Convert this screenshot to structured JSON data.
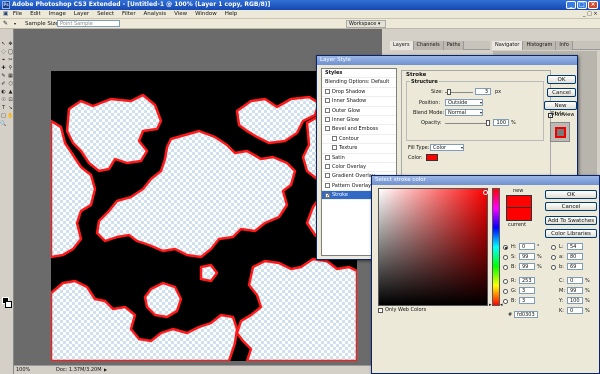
{
  "window": {
    "title": "Adobe Photoshop CS3 Extended - [Untitled-1 @ 100% (Layer 1 copy, RGB/8)]",
    "app_icon": "Ps"
  },
  "menu": [
    "File",
    "Edit",
    "Image",
    "Layer",
    "Select",
    "Filter",
    "Analysis",
    "View",
    "Window",
    "Help"
  ],
  "options": {
    "sample_size_label": "Sample Size:",
    "sample_size_value": "Point Sample",
    "workspace_label": "Workspace"
  },
  "status": {
    "zoom": "100%",
    "doc": "Doc: 1.37M/3.20M"
  },
  "panels": {
    "left_tabs": [
      "Layers",
      "Channels",
      "Paths"
    ],
    "right_tabs": [
      "Navigator",
      "Histogram",
      "Info"
    ]
  },
  "layer_style": {
    "title": "Layer Style",
    "list": [
      {
        "label": "Styles",
        "checkbox": false
      },
      {
        "label": "Blending Options: Default",
        "checkbox": false
      },
      {
        "label": "Drop Shadow",
        "checkbox": true
      },
      {
        "label": "Inner Shadow",
        "checkbox": true
      },
      {
        "label": "Outer Glow",
        "checkbox": true
      },
      {
        "label": "Inner Glow",
        "checkbox": true
      },
      {
        "label": "Bevel and Emboss",
        "checkbox": true
      },
      {
        "label": "Contour",
        "checkbox": true,
        "indent": true
      },
      {
        "label": "Texture",
        "checkbox": true,
        "indent": true
      },
      {
        "label": "Satin",
        "checkbox": true
      },
      {
        "label": "Color Overlay",
        "checkbox": true
      },
      {
        "label": "Gradient Overlay",
        "checkbox": true
      },
      {
        "label": "Pattern Overlay",
        "checkbox": true
      },
      {
        "label": "Stroke",
        "checkbox": true,
        "checked": true,
        "selected": true
      }
    ],
    "section_title": "Stroke",
    "group_title": "Structure",
    "size_label": "Size:",
    "size_value": "3",
    "size_unit": "px",
    "position_label": "Position:",
    "position_value": "Outside",
    "blend_label": "Blend Mode:",
    "blend_value": "Normal",
    "opacity_label": "Opacity:",
    "opacity_value": "100",
    "opacity_unit": "%",
    "fill_type_label": "Fill Type:",
    "fill_type_value": "Color",
    "color_label": "Color:",
    "stroke_color": "#ff0000",
    "ok": "OK",
    "cancel": "Cancel",
    "new_style": "New Style...",
    "preview": "Preview"
  },
  "color_picker": {
    "title": "Select stroke color",
    "new_label": "new",
    "current_label": "current",
    "new_color": "#ff0303",
    "current_color": "#ff0000",
    "ok": "OK",
    "cancel": "Cancel",
    "add_swatches": "Add To Swatches",
    "color_libraries": "Color Libraries",
    "only_web": "Only Web Colors",
    "hsb": [
      {
        "label": "H:",
        "value": "0",
        "unit": "°"
      },
      {
        "label": "S:",
        "value": "99",
        "unit": "%"
      },
      {
        "label": "B:",
        "value": "99",
        "unit": "%"
      }
    ],
    "rgb": [
      {
        "label": "R:",
        "value": "253"
      },
      {
        "label": "G:",
        "value": "3"
      },
      {
        "label": "B:",
        "value": "3"
      }
    ],
    "lab": [
      {
        "label": "L:",
        "value": "54"
      },
      {
        "label": "a:",
        "value": "80"
      },
      {
        "label": "b:",
        "value": "69"
      }
    ],
    "cmyk": [
      {
        "label": "C:",
        "value": "0",
        "unit": "%"
      },
      {
        "label": "M:",
        "value": "99",
        "unit": "%"
      },
      {
        "label": "Y:",
        "value": "100",
        "unit": "%"
      },
      {
        "label": "K:",
        "value": "0",
        "unit": "%"
      }
    ],
    "hex_label": "#",
    "hex_value": "fd0303"
  }
}
